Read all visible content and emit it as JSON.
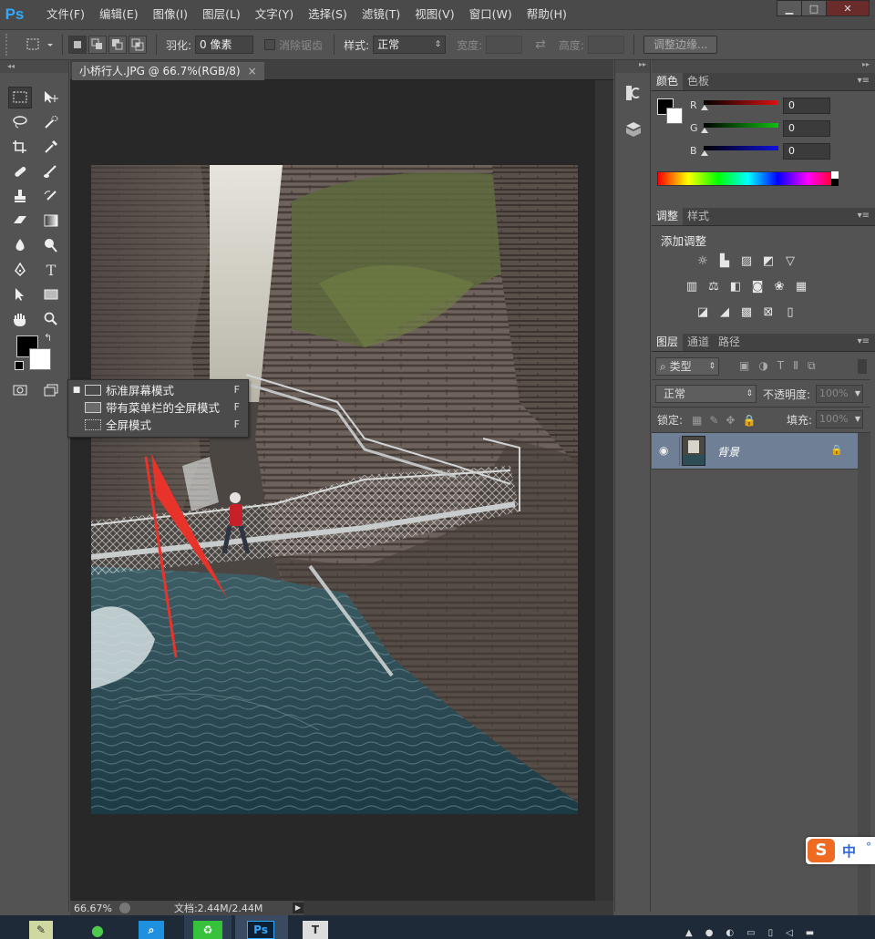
{
  "app": {
    "logo": "Ps"
  },
  "menu": [
    "文件(F)",
    "编辑(E)",
    "图像(I)",
    "图层(L)",
    "文字(Y)",
    "选择(S)",
    "滤镜(T)",
    "视图(V)",
    "窗口(W)",
    "帮助(H)"
  ],
  "window_controls": {
    "minimize": "▁",
    "maximize": "□",
    "close": "✕"
  },
  "options": {
    "feather_label": "羽化:",
    "feather_value": "0 像素",
    "antialias_label": "消除锯齿",
    "style_label": "样式:",
    "style_value": "正常",
    "width_label": "宽度:",
    "swap_icon": "⇄",
    "height_label": "高度:",
    "refine_edge": "调整边缘..."
  },
  "document": {
    "tab_title": "小桥行人.JPG @ 66.7%(RGB/8)",
    "tab_close": "×",
    "zoom": "66.67%",
    "doc_size": "文档:2.44M/2.44M"
  },
  "screen_mode_menu": [
    {
      "label": "标准屏幕模式",
      "shortcut": "F",
      "checked": true
    },
    {
      "label": "带有菜单栏的全屏模式",
      "shortcut": "F",
      "checked": false
    },
    {
      "label": "全屏模式",
      "shortcut": "F",
      "checked": false
    }
  ],
  "color_panel": {
    "tabs": [
      "颜色",
      "色板"
    ],
    "channels": [
      {
        "name": "R",
        "value": "0",
        "color": "#e01010"
      },
      {
        "name": "G",
        "value": "0",
        "color": "#10c010"
      },
      {
        "name": "B",
        "value": "0",
        "color": "#1010e0"
      }
    ]
  },
  "adjust_panel": {
    "tabs": [
      "调整",
      "样式"
    ],
    "heading": "添加调整"
  },
  "layers_panel": {
    "tabs": [
      "图层",
      "通道",
      "路径"
    ],
    "filter_label": "类型",
    "blend_mode": "正常",
    "opacity_label": "不透明度:",
    "opacity_value": "100%",
    "lock_label": "锁定:",
    "fill_label": "填充:",
    "fill_value": "100%",
    "layers": [
      {
        "name": "背景",
        "visible": true,
        "locked": true
      }
    ]
  },
  "ime": {
    "label": "中"
  },
  "taskbar": {
    "apps": [
      "Ps",
      "T"
    ]
  },
  "colors": {
    "accent": "#31a8ff",
    "arrow": "#e8332a",
    "layer_selected": "#6f7f96"
  }
}
